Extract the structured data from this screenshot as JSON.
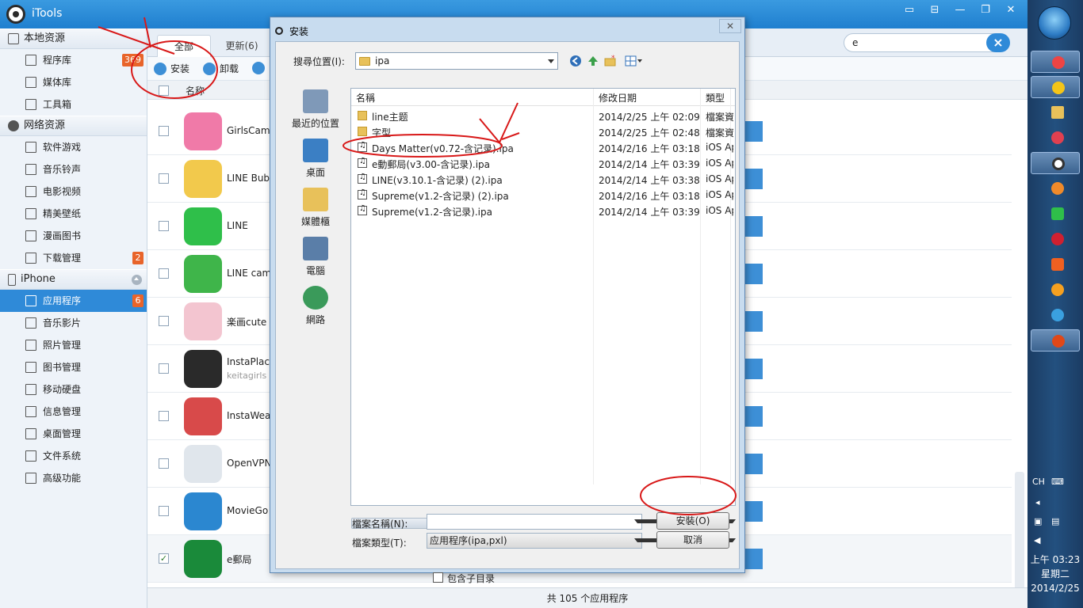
{
  "app": {
    "title": "iTools"
  },
  "window_controls": [
    "▭",
    "⊟",
    "—",
    "❐",
    "✕"
  ],
  "sidebar": {
    "local": {
      "title": "本地资源",
      "items": [
        {
          "label": "程序库",
          "badge": "369"
        },
        {
          "label": "媒体库"
        },
        {
          "label": "工具箱"
        }
      ]
    },
    "network": {
      "title": "网络资源",
      "items": [
        {
          "label": "软件游戏"
        },
        {
          "label": "音乐铃声"
        },
        {
          "label": "电影视频"
        },
        {
          "label": "精美壁纸"
        },
        {
          "label": "漫画图书"
        },
        {
          "label": "下载管理",
          "badge": "2"
        }
      ]
    },
    "device": {
      "title": "iPhone",
      "items": [
        {
          "label": "应用程序",
          "badge": "6"
        },
        {
          "label": "音乐影片"
        },
        {
          "label": "照片管理"
        },
        {
          "label": "图书管理"
        },
        {
          "label": "移动硬盘"
        },
        {
          "label": "信息管理"
        },
        {
          "label": "桌面管理"
        },
        {
          "label": "文件系统"
        },
        {
          "label": "高级功能"
        }
      ]
    }
  },
  "tabs": [
    {
      "label": "全部"
    },
    {
      "label": "更新(6)"
    }
  ],
  "search": {
    "value": "e"
  },
  "toolbar": {
    "install": "安装",
    "uninstall": "卸载"
  },
  "table": {
    "col_name": "名称"
  },
  "apps": [
    {
      "name": "GirlsCame",
      "color": "#f07aa8"
    },
    {
      "name": "LINE Bubb",
      "color": "#f2c94c"
    },
    {
      "name": "LINE",
      "color": "#2fbf4a"
    },
    {
      "name": "LINE cam",
      "color": "#3fb54a"
    },
    {
      "name": "楽画cute",
      "color": "#f3c5d0"
    },
    {
      "name": "InstaPlace",
      "sub": "keitagirls",
      "color": "#2a2a2a"
    },
    {
      "name": "InstaWeat",
      "color": "#d84a4a"
    },
    {
      "name": "OpenVPN",
      "color": "#e0e6ec"
    },
    {
      "name": "MovieGo",
      "color": "#2b87d0"
    },
    {
      "name": "e郵局",
      "color": "#1a8a3a",
      "checked": true
    }
  ],
  "status": "共 105 个应用程序",
  "dialog": {
    "title": "安装",
    "close": "✕",
    "look_in_label": "搜尋位置(I):",
    "look_in_value": "ipa",
    "places": [
      {
        "label": "最近的位置",
        "color": "#7f99b8"
      },
      {
        "label": "桌面",
        "color": "#3b7fc4"
      },
      {
        "label": "媒體櫃",
        "color": "#e8c15a"
      },
      {
        "label": "電腦",
        "color": "#5a7ea8"
      },
      {
        "label": "網路",
        "color": "#3a9a5a"
      }
    ],
    "columns": {
      "name": "名稱",
      "date": "修改日期",
      "type": "類型"
    },
    "files": [
      {
        "name": "line主题",
        "date": "2014/2/25 上午 02:09",
        "type": "檔案資料夾",
        "kind": "folder"
      },
      {
        "name": "字型",
        "date": "2014/2/25 上午 02:48",
        "type": "檔案資料夾",
        "kind": "folder"
      },
      {
        "name": "Days Matter(v0.72-含记录).ipa",
        "date": "2014/2/16 上午 03:18",
        "type": "iOS App",
        "kind": "file"
      },
      {
        "name": "e動郵局(v3.00-含记录).ipa",
        "date": "2014/2/14 上午 03:39",
        "type": "iOS App",
        "kind": "file"
      },
      {
        "name": "LINE(v3.10.1-含记录) (2).ipa",
        "date": "2014/2/14 上午 03:38",
        "type": "iOS App",
        "kind": "file"
      },
      {
        "name": "Supreme(v1.2-含记录) (2).ipa",
        "date": "2014/2/16 上午 03:18",
        "type": "iOS App",
        "kind": "file"
      },
      {
        "name": "Supreme(v1.2-含记录).ipa",
        "date": "2014/2/14 上午 03:39",
        "type": "iOS App",
        "kind": "file"
      }
    ],
    "filename_label": "檔案名稱(N):",
    "filename_value": "",
    "filetype_label": "檔案類型(T):",
    "filetype_value": "应用程序(ipa,pxl)",
    "install_button": "安裝(O)",
    "cancel_button": "取消",
    "include_sub": "包含子目录"
  },
  "taskbar": {
    "lang": "CH",
    "time": "上午 03:23",
    "weekday": "星期二",
    "date": "2014/2/25"
  }
}
